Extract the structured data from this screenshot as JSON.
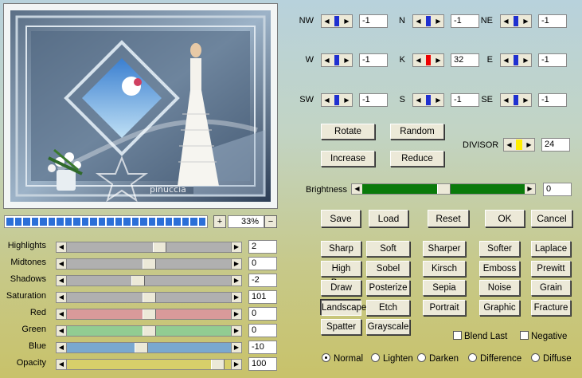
{
  "zoom": {
    "value": "33%",
    "plus": "+",
    "minus": "−",
    "segments": 24
  },
  "watermark": {
    "brand": "pinuccia",
    "site": "www.maidiregrafica.eu"
  },
  "sliders": [
    {
      "label": "Highlights",
      "value": "2",
      "thumb": 0.57,
      "color": "#b0b0b0"
    },
    {
      "label": "Midtones",
      "value": "0",
      "thumb": 0.5,
      "color": "#b0b0b0"
    },
    {
      "label": "Shadows",
      "value": "-2",
      "thumb": 0.43,
      "color": "#b0b0b0"
    },
    {
      "label": "Saturation",
      "value": "101",
      "thumb": 0.5,
      "color": "#b0b0b0"
    },
    {
      "label": "Red",
      "value": "0",
      "thumb": 0.5,
      "color": "#d99a9a"
    },
    {
      "label": "Green",
      "value": "0",
      "thumb": 0.5,
      "color": "#92cc92"
    },
    {
      "label": "Blue",
      "value": "-10",
      "thumb": 0.45,
      "color": "#7aa8cf"
    },
    {
      "label": "Opacity",
      "value": "100",
      "thumb": 0.96,
      "color": "#d7cf6a"
    }
  ],
  "directions": [
    {
      "label": "NW",
      "value": "-1"
    },
    {
      "label": "N",
      "value": "-1"
    },
    {
      "label": "NE",
      "value": "-1"
    },
    {
      "label": "W",
      "value": "-1"
    },
    {
      "label": "K",
      "value": "32"
    },
    {
      "label": "E",
      "value": "-1"
    },
    {
      "label": "SW",
      "value": "-1"
    },
    {
      "label": "S",
      "value": "-1"
    },
    {
      "label": "SE",
      "value": "-1"
    }
  ],
  "buttons": {
    "rotate": "Rotate",
    "random": "Random",
    "increase": "Increase",
    "reduce": "Reduce",
    "save": "Save",
    "load": "Load",
    "reset": "Reset",
    "ok": "OK",
    "cancel": "Cancel"
  },
  "divisor": {
    "label": "DIVISOR",
    "value": "24"
  },
  "brightness": {
    "label": "Brightness",
    "value": "0",
    "thumb": 0.5
  },
  "presets": [
    [
      "Sharp",
      "Soft",
      "Sharper",
      "Softer",
      "Laplace"
    ],
    [
      "High Pass",
      "Sobel",
      "Kirsch",
      "Emboss",
      "Prewitt"
    ],
    [
      "Draw",
      "Posterize",
      "Sepia",
      "Noise",
      "Grain"
    ],
    [
      "Landscape",
      "Etch",
      "Portrait",
      "Graphic",
      "Fracture"
    ],
    [
      "Spatter",
      "Grayscale"
    ]
  ],
  "checkboxes": {
    "blend_last": "Blend Last",
    "negative": "Negative"
  },
  "blend_modes": [
    "Normal",
    "Lighten",
    "Darken",
    "Difference",
    "Diffuse"
  ],
  "blend_selected": "Normal"
}
